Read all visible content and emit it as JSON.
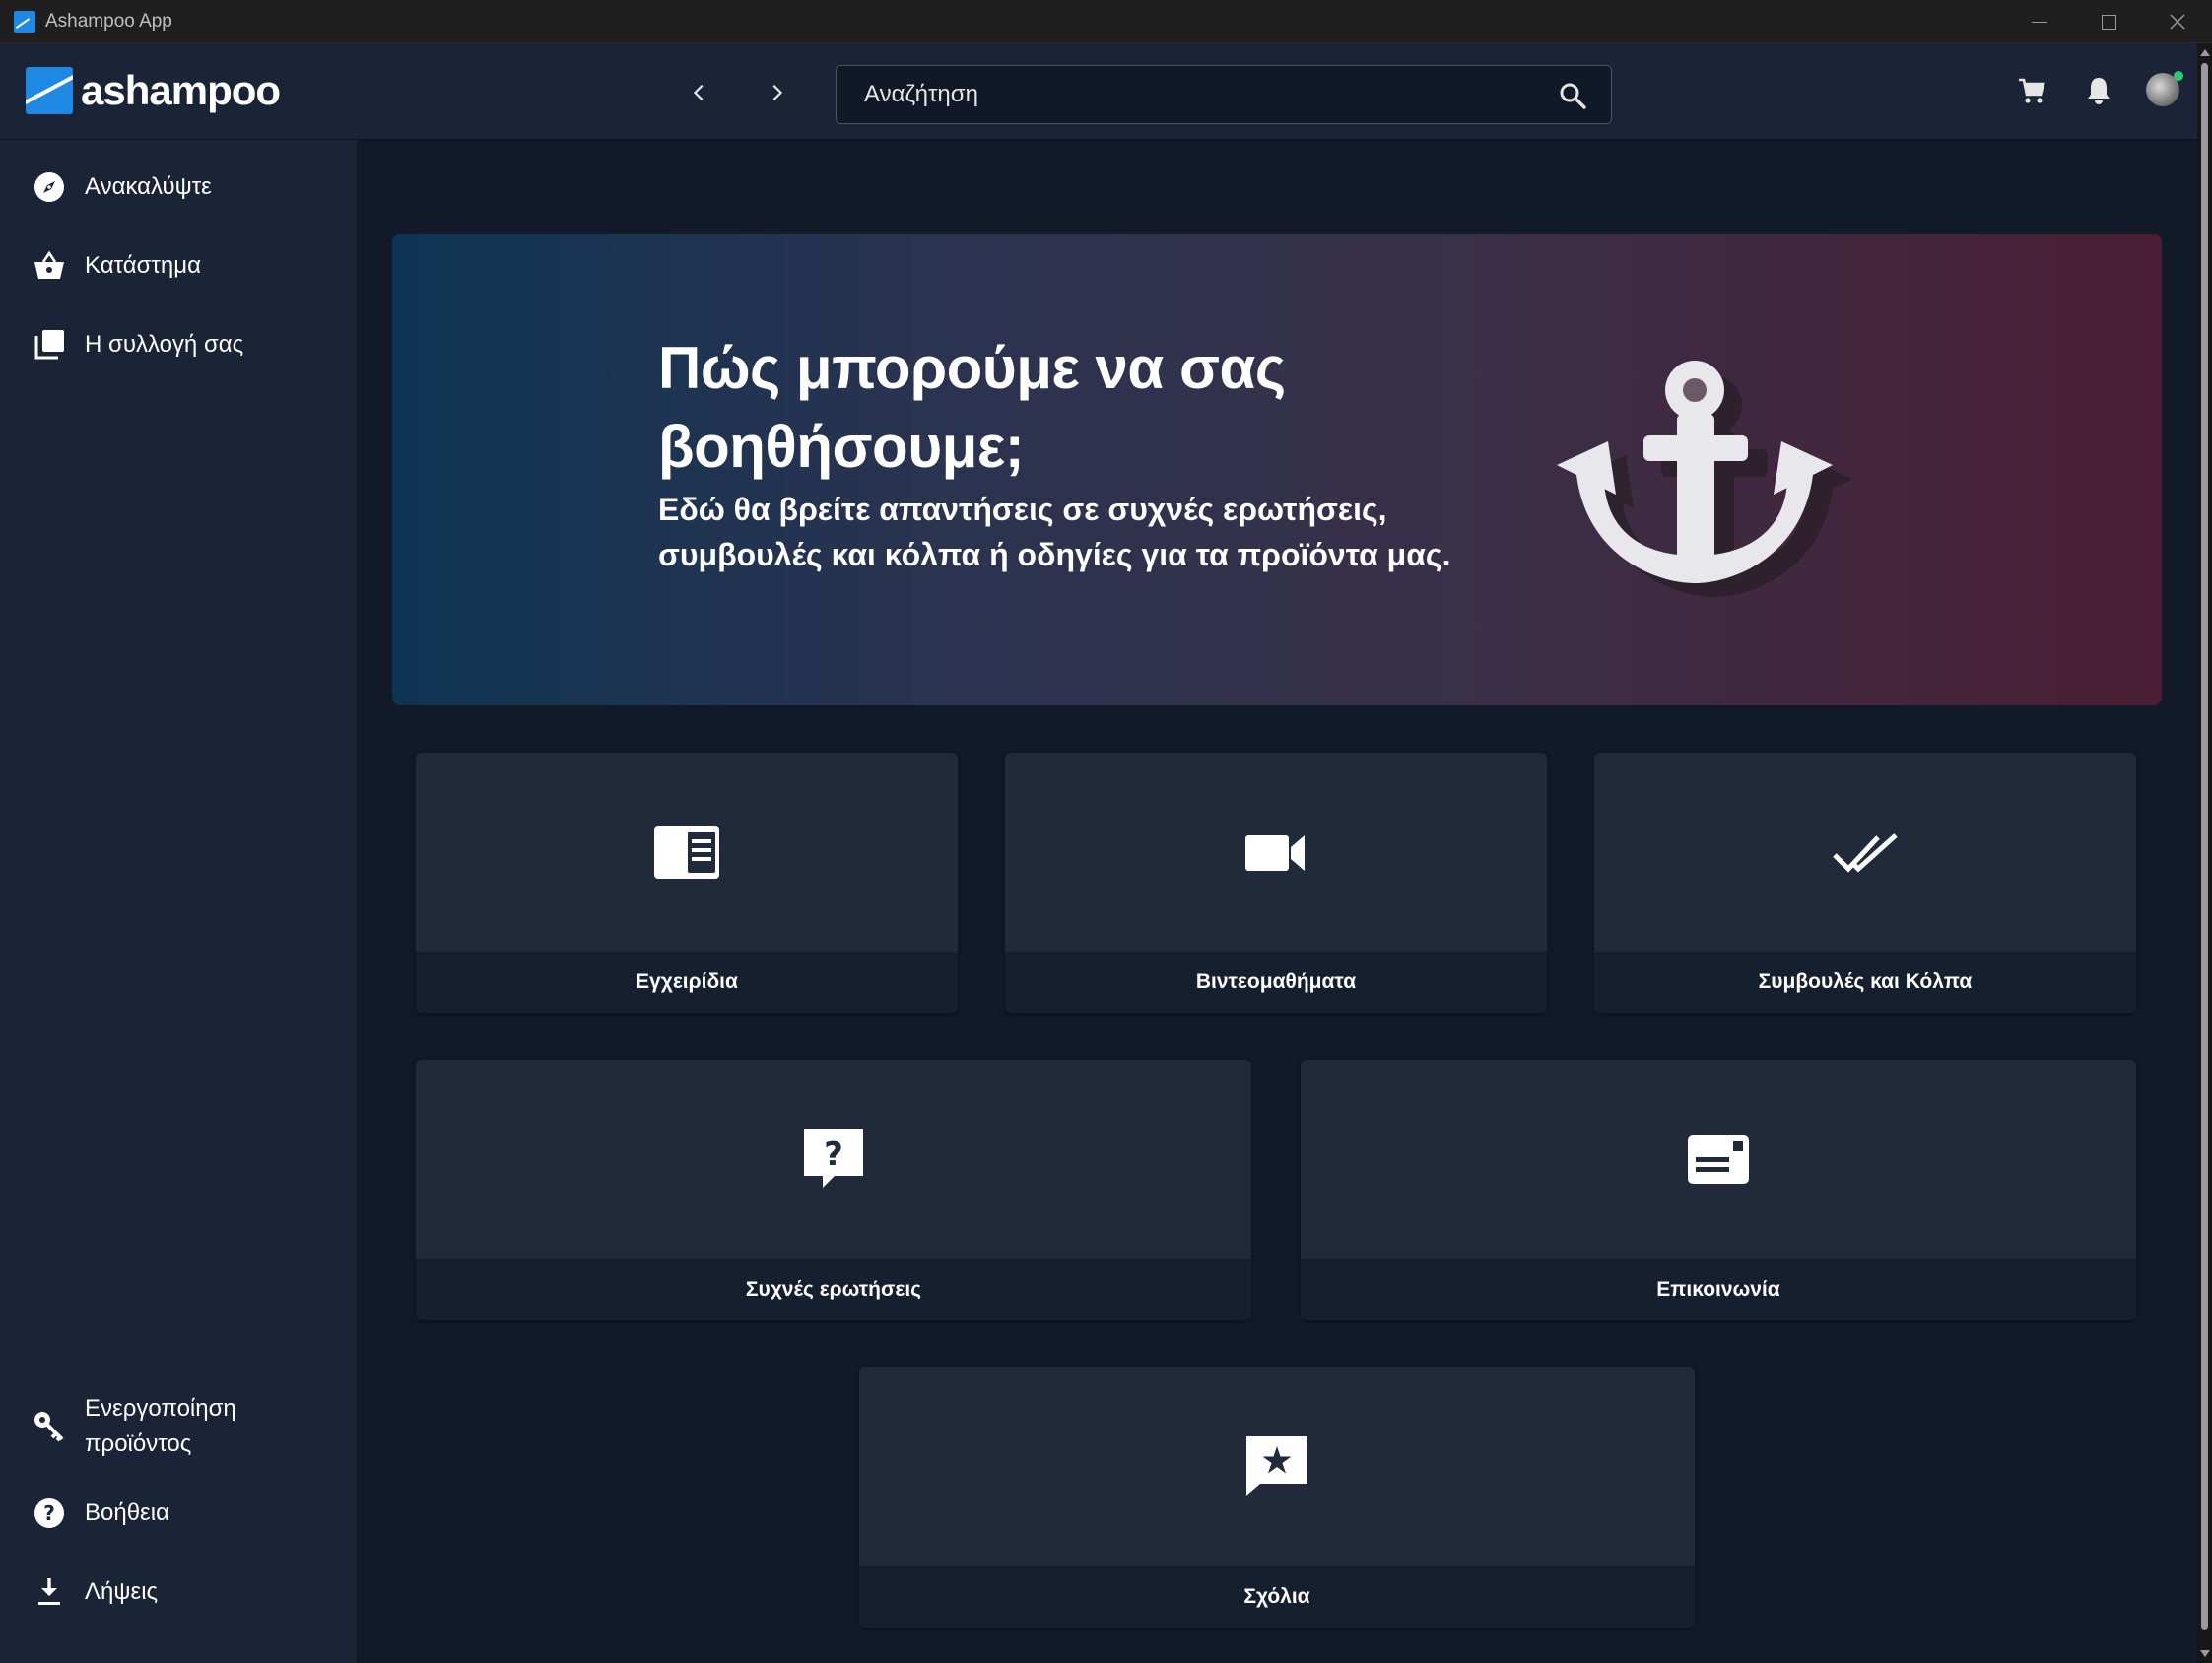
{
  "window": {
    "title": "Ashampoo App"
  },
  "header": {
    "logo_text": "ashampoo",
    "search_placeholder": "Αναζήτηση"
  },
  "sidebar": {
    "top_items": [
      {
        "label": "Ανακαλύψτε",
        "icon": "compass-icon"
      },
      {
        "label": "Κατάστημα",
        "icon": "basket-icon"
      },
      {
        "label": "Η συλλογή σας",
        "icon": "collection-icon"
      }
    ],
    "bottom_items": [
      {
        "label": "Ενεργοποίηση προϊόντος",
        "icon": "key-icon"
      },
      {
        "label": "Βοήθεια",
        "icon": "help-icon"
      },
      {
        "label": "Λήψεις",
        "icon": "download-icon"
      }
    ]
  },
  "hero": {
    "title": "Πώς μπορούμε να σας βοηθήσουμε;",
    "subtitle": "Εδώ θα βρείτε απαντήσεις σε συχνές ερωτήσεις, συμβουλές και κόλπα ή οδηγίες για τα προϊόντα μας."
  },
  "cards": [
    {
      "label": "Εγχειρίδια",
      "icon": "manual-icon"
    },
    {
      "label": "Βιντεομαθήματα",
      "icon": "video-camera-icon"
    },
    {
      "label": "Συμβουλές και Κόλπα",
      "icon": "double-check-icon"
    },
    {
      "label": "Συχνές ερωτήσεις",
      "icon": "question-bubble-icon"
    },
    {
      "label": "Επικοινωνία",
      "icon": "contact-card-icon"
    },
    {
      "label": "Σχόλια",
      "icon": "feedback-star-icon"
    }
  ],
  "colors": {
    "background": "#121a2a",
    "panel": "#1b2436",
    "card": "#212a3b",
    "card_footer": "#161f30",
    "brand": "#1e88e5"
  }
}
